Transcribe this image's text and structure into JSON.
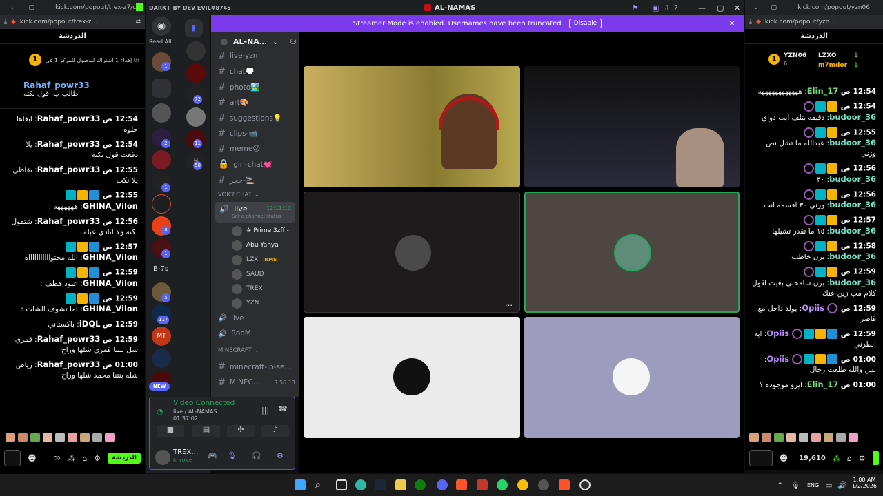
{
  "left_window": {
    "title": "kick.com/popout/trex-z7/c…",
    "url": "kick.com/popout/trex-z…"
  },
  "right_window": {
    "title": "kick.com/popout/yzn06…",
    "url": "kick.com/popout/yzn…"
  },
  "discord": {
    "title": "DARK+ BY DEV EVIL#8745",
    "server_title": "AL-NAMAS",
    "banner_text": "Streamer Mode is enabled. Usernames have been truncated.",
    "banner_button": "Disable",
    "read_all": "Read All",
    "new_label": "NEW",
    "guild_letters": "B-7s",
    "server_name": "AL-NA…",
    "channels": [
      "live-yzn",
      "chat💭",
      "photo🏞️",
      "art🎨",
      "suggestions💡",
      "clips-📹",
      "meme😜",
      "girl-chat💓",
      "حجز-🚬"
    ],
    "voice_category": "VOICECHAT",
    "live_channel": "live",
    "live_time": "12:11:10",
    "channel_status_placeholder": "Set a channel status",
    "voice_users": [
      "# Prime 3zff -",
      "Abu Yahya",
      "LZX",
      "SAUD",
      "TREX",
      "YZN"
    ],
    "nms_tag": "NMS",
    "voice_channels2": [
      "live",
      "RooM"
    ],
    "minecraft_category": "MINECRAFT",
    "mc_channels": [
      "minecraft-ip-se…",
      "MINEC…"
    ],
    "mc_time": "3:56:13",
    "video_connected": "Video Connected",
    "video_sub": "live / AL-NAMAS",
    "video_time": "01:37:02",
    "user_name": "TREX…",
    "user_status": "In voice",
    "guild_badges": [
      "1",
      "2",
      "1",
      "8",
      "117",
      "5",
      "1",
      "72",
      "11",
      "50",
      "1",
      "8"
    ]
  },
  "left_chat": {
    "header": "الدردشة",
    "pinned": "إهداء 1 اشتراك للوصول للمركز 1 في th",
    "pinned_user": "Rahaf_powr33",
    "pinned_text": "طالب ب اقول نكته",
    "messages": [
      {
        "time": "12:54 ص",
        "user": "Rahaf_powr33",
        "color": "#ffffff",
        "badges": [],
        "text": "ابغاها حلوه"
      },
      {
        "time": "12:54 ص",
        "user": "Rahaf_powr33",
        "color": "#ffffff",
        "badges": [],
        "text": "يلا دفعت قول نكته"
      },
      {
        "time": "12:55 ص",
        "user": "Rahaf_powr33",
        "color": "#ffffff",
        "badges": [],
        "text": "نقاطي يلا نكت"
      },
      {
        "time": "12:55 ص",
        "user": "GHINA_Vilon",
        "color": "#ffffff",
        "badges": [
          "b-blue",
          "b-gold",
          "b-teal"
        ],
        "text": "ههههههه :"
      },
      {
        "time": "12:56 ص",
        "user": "Rahaf_powr33",
        "color": "#ffffff",
        "badges": [],
        "text": "شتقول نكته ولا انادي عبله"
      },
      {
        "time": "12:57 ص",
        "user": "GHINA_Vilon",
        "color": "#ffffff",
        "badges": [
          "b-blue",
          "b-gold",
          "b-teal"
        ],
        "text": "الله محتواااااااااااه"
      },
      {
        "time": "12:59 ص",
        "user": "GHINA_Vilon",
        "color": "#ffffff",
        "badges": [
          "b-blue",
          "b-gold",
          "b-teal"
        ],
        "text": "عبود هطف :"
      },
      {
        "time": "12:59 ص",
        "user": "GHINA_Vilon",
        "color": "#ffffff",
        "badges": [
          "b-blue",
          "b-gold",
          "b-teal"
        ],
        "text": "اما تشوف الشات :"
      },
      {
        "time": "12:59 ص",
        "user": "iDQL",
        "color": "#ffffff",
        "badges": [],
        "text": "باكستاني"
      },
      {
        "time": "12:59 ص",
        "user": "Rahaf_powr33",
        "color": "#ffffff",
        "badges": [],
        "text": "قمري شل بنتنا قمري شلها وراح"
      },
      {
        "time": "01:00 ص",
        "user": "Rahaf_powr33",
        "color": "#ffffff",
        "badges": [],
        "text": "رياض شله بنتنا محمد شلها وراح"
      }
    ]
  },
  "right_chat": {
    "header": "الدردشة",
    "top_user1": "YZN06",
    "top_count1": "6",
    "top_user2": "LZXO",
    "top_user3": "m7mdor",
    "top_val": "1",
    "messages": [
      {
        "time": "12:54 ص",
        "user": "Elin_17",
        "color": "#6ee07a",
        "badges": [],
        "text": "ههههههههههههه"
      },
      {
        "time": "12:54 ص",
        "user": "budoor_36",
        "color": "#6ee0c8",
        "badges": [
          "b-gold",
          "b-teal",
          "b-purple"
        ],
        "text": "دقيقه بتلف ايب دواي"
      },
      {
        "time": "12:55 ص",
        "user": "budoor_36",
        "color": "#6ee0c8",
        "badges": [
          "b-gold",
          "b-teal",
          "b-purple"
        ],
        "text": "عبدالله ما تشل نص وزني"
      },
      {
        "time": "12:56 ص",
        "user": "budoor_36",
        "color": "#6ee0c8",
        "badges": [
          "b-gold",
          "b-teal",
          "b-purple"
        ],
        "text": "٣٠"
      },
      {
        "time": "12:56 ص",
        "user": "budoor_36",
        "color": "#6ee0c8",
        "badges": [
          "b-gold",
          "b-teal",
          "b-purple"
        ],
        "text": "وزني ٣٠ اقسمه انت"
      },
      {
        "time": "12:57 ص",
        "user": "budoor_36",
        "color": "#6ee0c8",
        "badges": [
          "b-gold",
          "b-teal",
          "b-purple"
        ],
        "text": "١٥ ما تقدر تشيلها"
      },
      {
        "time": "12:58 ص",
        "user": "budoor_36",
        "color": "#6ee0c8",
        "badges": [
          "b-gold",
          "b-teal",
          "b-purple"
        ],
        "text": "يزن خاطب"
      },
      {
        "time": "12:59 ص",
        "user": "budoor_36",
        "color": "#6ee0c8",
        "badges": [
          "b-gold",
          "b-teal",
          "b-purple"
        ],
        "text": "يزن سامحني بغيت اقول كلام مب زين عنك"
      },
      {
        "time": "12:59 ص",
        "user": "Opiis",
        "color": "#b98cff",
        "badges": [
          "b-purple"
        ],
        "text": "يولد داخل مع قاصر"
      },
      {
        "time": "12:59 ص",
        "user": "Opiis",
        "color": "#b98cff",
        "badges": [
          "b-blue",
          "b-gold",
          "b-teal",
          "b-purple"
        ],
        "text": "ايه انطرني"
      },
      {
        "time": "01:00 ص",
        "user": "Opiis",
        "color": "#b98cff",
        "badges": [
          "b-blue",
          "b-gold",
          "b-teal",
          "b-purple"
        ],
        "text": "بس والله طلعت رجال"
      },
      {
        "time": "01:00 ص",
        "user": "Elin_17",
        "color": "#6ee07a",
        "badges": [],
        "text": "ايزو موجوده ؟"
      }
    ],
    "points": "19,610"
  },
  "left_footer": {
    "send_label": "الدردشة",
    "infinity": "∞"
  },
  "taskbar": {
    "lang": "ENG",
    "time": "1:00 AM",
    "date": "1/2/2026"
  }
}
